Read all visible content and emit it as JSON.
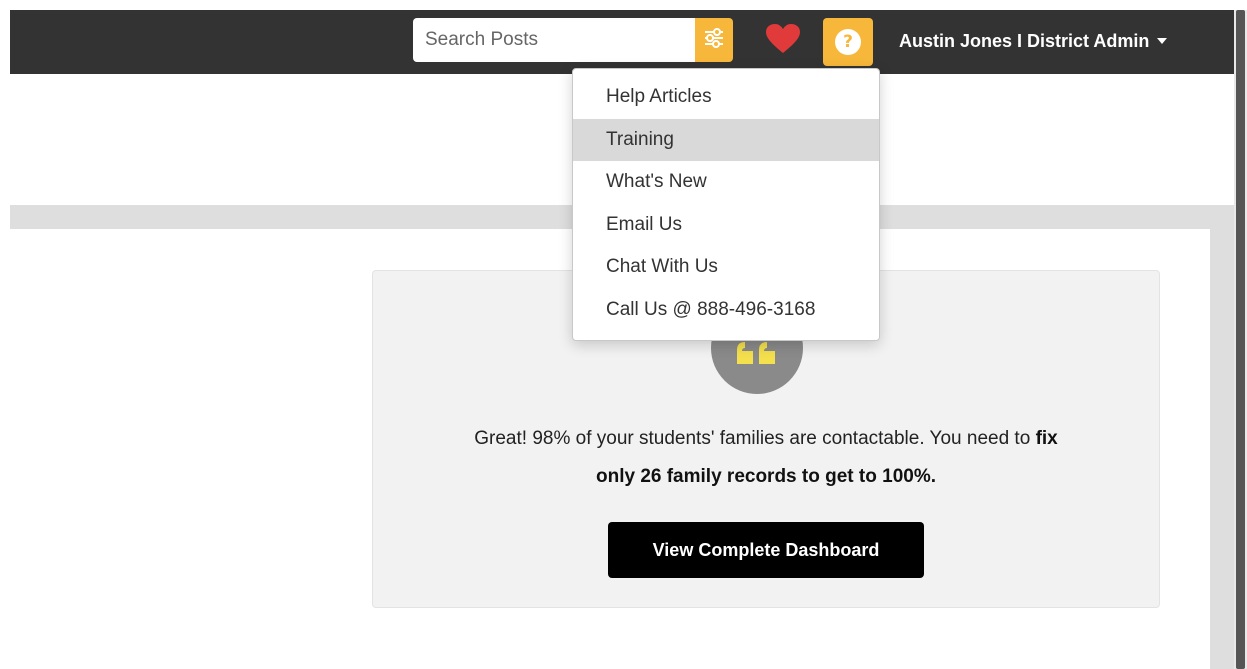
{
  "header": {
    "search_placeholder": "Search Posts",
    "user_label": "Austin Jones I District Admin",
    "icons": {
      "filter": "sliders-icon",
      "favorites": "heart-icon",
      "help": "question-icon",
      "user_caret": "caret-down-icon"
    }
  },
  "help_menu": {
    "items": [
      {
        "label": "Help Articles"
      },
      {
        "label": "Training"
      },
      {
        "label": "What's New"
      },
      {
        "label": "Email Us"
      },
      {
        "label": "Chat With Us"
      },
      {
        "label": "Call Us @ 888-496-3168"
      }
    ],
    "highlighted": "Training"
  },
  "panel": {
    "icon": "quote-icon",
    "message_part1": "Great! 98% of your students' families are contactable. You need to ",
    "message_bold1": "fix",
    "message_bold2": "only 26 family records",
    "message_part2": " to get to 100%.",
    "cta_label": "View Complete Dashboard"
  },
  "colors": {
    "navbar": "#333333",
    "accent": "#f7b73b",
    "heart": "#e03a3a",
    "quote_yellow": "#f4e04d"
  }
}
